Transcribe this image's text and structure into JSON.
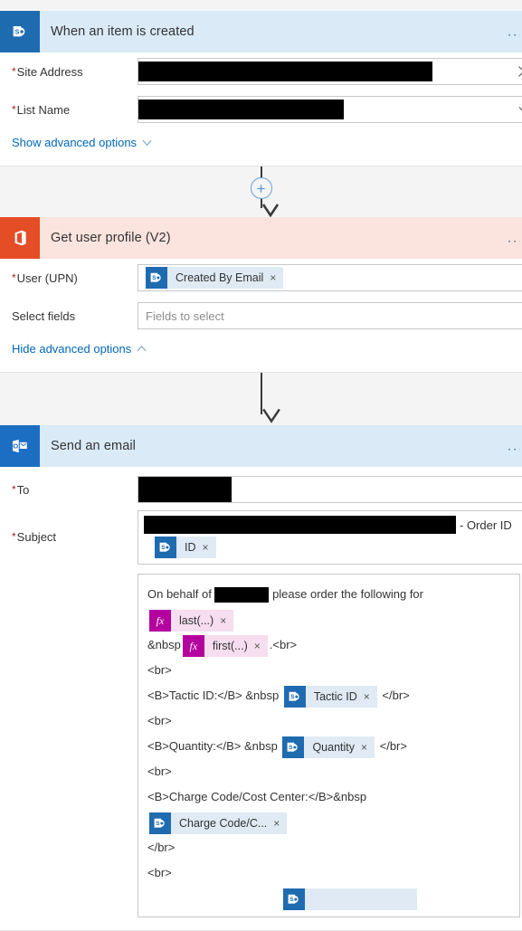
{
  "app": {
    "name": "Power Automate flow designer",
    "redacted_marker": "redacted"
  },
  "cards": [
    {
      "id": "trigger-sharepoint",
      "title": "When an item is created",
      "connector_icon": "sharepoint-icon",
      "header_color": "#daeaf7",
      "icon_color": "#1f6bb0",
      "overflow_label": "...",
      "fields": [
        {
          "label": "Site Address",
          "required": true,
          "value_redacted": true,
          "redaction_width": 325,
          "trailing_icon": "clear-icon",
          "icon_glyph": "✕"
        },
        {
          "label": "List Name",
          "required": true,
          "value_redacted": true,
          "redaction_width": 227,
          "trailing_icon": "chevron-down-icon",
          "icon_glyph": "⌄"
        }
      ],
      "advanced_toggle": "Show advanced options",
      "advanced_state": "collapsed"
    },
    {
      "id": "get-user-profile",
      "title": "Get user profile (V2)",
      "connector_icon": "office365-icon",
      "header_color": "#fbe4de",
      "icon_color": "#e44d26",
      "overflow_label": "...",
      "fields": [
        {
          "label": "User (UPN)",
          "required": true,
          "token": {
            "type": "sharepoint",
            "label": "Created By Email",
            "remove": "×"
          }
        },
        {
          "label": "Select fields",
          "required": false,
          "placeholder": "Fields to select"
        }
      ],
      "advanced_toggle": "Hide advanced options",
      "advanced_state": "expanded"
    },
    {
      "id": "send-an-email",
      "title": "Send an email",
      "connector_icon": "outlook-icon",
      "header_color": "#daeaf7",
      "icon_color": "#1b6ec2",
      "overflow_label": "...",
      "fields": [
        {
          "label": "To",
          "required": true,
          "value_redacted": true,
          "redaction_width": 103
        },
        {
          "label": "Subject",
          "required": true,
          "subject_redaction_width": 345,
          "subject_suffix": "- Order ID",
          "token": {
            "type": "sharepoint",
            "label": "ID",
            "remove": "×"
          }
        }
      ]
    }
  ],
  "email_body": {
    "lines": [
      {
        "parts": [
          {
            "kind": "text",
            "text": "On behalf of "
          },
          {
            "kind": "redaction",
            "width": 60
          },
          {
            "kind": "text",
            "text": " please order the following for "
          },
          {
            "kind": "token",
            "type": "fx",
            "icon": "fx",
            "label": "last(...)",
            "remove": "×"
          }
        ]
      },
      {
        "parts": [
          {
            "kind": "text",
            "text": "&nbsp"
          },
          {
            "kind": "token",
            "type": "fx",
            "icon": "fx",
            "label": "first(...)",
            "remove": "×"
          },
          {
            "kind": "text",
            "text": ".<br>"
          }
        ]
      },
      {
        "parts": [
          {
            "kind": "text",
            "text": "<br>"
          }
        ]
      },
      {
        "parts": [
          {
            "kind": "text",
            "text": "<B>Tactic ID:</B> &nbsp "
          },
          {
            "kind": "token",
            "type": "sharepoint",
            "label": "Tactic ID",
            "remove": "×"
          },
          {
            "kind": "text",
            "text": " </br>"
          }
        ]
      },
      {
        "parts": [
          {
            "kind": "text",
            "text": "<br>"
          }
        ]
      },
      {
        "parts": [
          {
            "kind": "text",
            "text": "<B>Quantity:</B> &nbsp "
          },
          {
            "kind": "token",
            "type": "sharepoint",
            "label": "Quantity",
            "remove": "×"
          },
          {
            "kind": "text",
            "text": " </br>"
          }
        ]
      },
      {
        "parts": [
          {
            "kind": "text",
            "text": "<br>"
          }
        ]
      },
      {
        "parts": [
          {
            "kind": "text",
            "text": "<B>Charge Code/Cost Center:</B>&nbsp "
          },
          {
            "kind": "token",
            "type": "sharepoint",
            "label": "Charge Code/C...",
            "remove": "×"
          }
        ]
      },
      {
        "parts": [
          {
            "kind": "text",
            "text": "</br>"
          }
        ]
      },
      {
        "parts": [
          {
            "kind": "text",
            "text": "<br>"
          }
        ]
      },
      {
        "parts": [
          {
            "kind": "token",
            "type": "sharepoint",
            "label": "",
            "remove": "",
            "partial": true
          }
        ]
      }
    ]
  },
  "connectors": [
    {
      "id": "connector-1",
      "has_add_button": true,
      "add_label": "+"
    },
    {
      "id": "connector-2",
      "has_add_button": false,
      "add_label": ""
    }
  ]
}
